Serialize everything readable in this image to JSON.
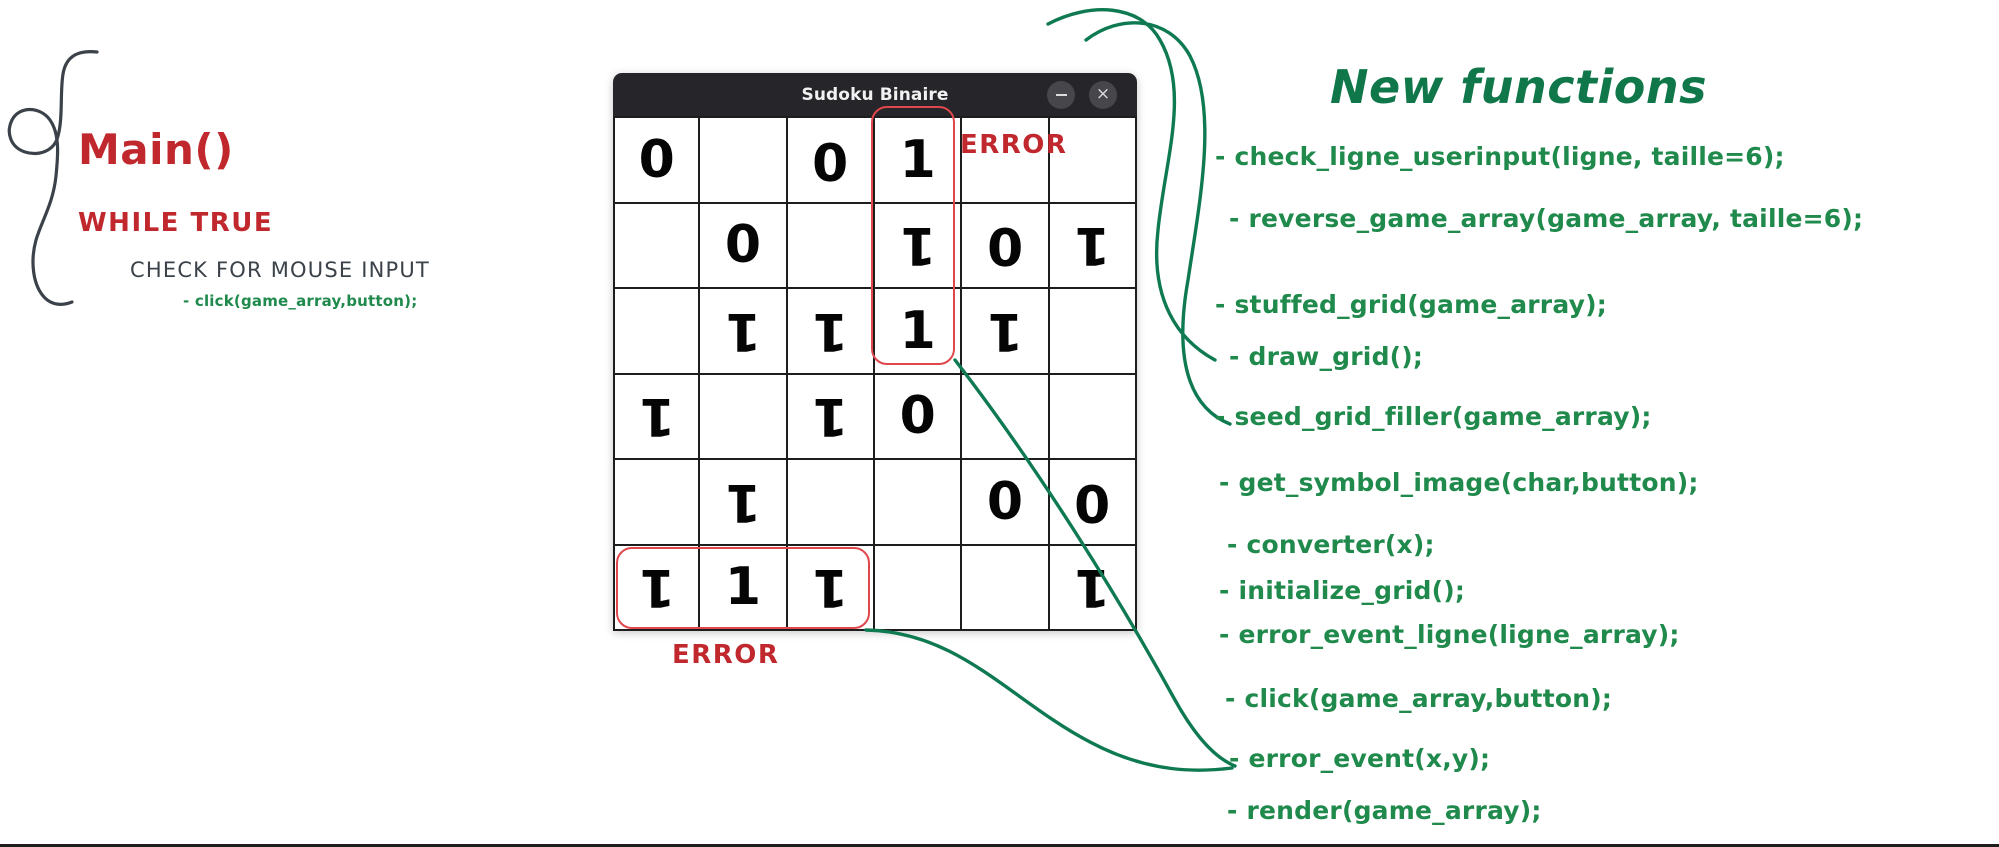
{
  "left_panel": {
    "main_label": "Main()",
    "while_label": "WHILE TRUE",
    "check_label": "CHECK FOR MOUSE INPUT",
    "click_label": "- click(game_array,button);"
  },
  "app_window": {
    "title": "Sudoku Binaire",
    "minimize_label": "–",
    "close_label": "×"
  },
  "annotations": {
    "error_top": "ERROR",
    "error_bottom": "ERROR"
  },
  "functions_panel": {
    "title": "New functions",
    "items": [
      "- check_ligne_userinput(ligne, taille=6);",
      "- reverse_game_array(game_array, taille=6);",
      "- stuffed_grid(game_array);",
      "- draw_grid();",
      "- seed_grid_filler(game_array);",
      "- get_symbol_image(char,button);",
      "- converter(x);",
      "- initialize_grid();",
      "- error_event_ligne(ligne_array);",
      "- click(game_array,button);",
      "- error_event(x,y);",
      "- render(game_array);"
    ]
  },
  "colors": {
    "red_accent": "#c0282d",
    "green_accent": "#1f8a4c",
    "green_title": "#10774a",
    "ink": "#3b4249",
    "titlebar": "#26262a",
    "error_box": "#e0474c"
  },
  "chart_data": {
    "type": "table",
    "title": "Sudoku Binaire",
    "rows": 6,
    "cols": 6,
    "legend": {
      "0": "zero symbol, upright",
      "0r": "zero symbol, rotated 180 degrees",
      "1": "one symbol, upright",
      "1r": "one symbol, rotated 180 degrees",
      "": "empty cell"
    },
    "cells": [
      [
        "0",
        "",
        "0r",
        "1",
        "",
        ""
      ],
      [
        "",
        "0",
        "",
        "1r",
        "0r",
        "1r"
      ],
      [
        "",
        "1r",
        "1r",
        "1",
        "1r",
        ""
      ],
      [
        "1r",
        "",
        "1r",
        "0",
        "",
        ""
      ],
      [
        "",
        "1r",
        "",
        "",
        "0",
        "0r"
      ],
      [
        "1r",
        "1",
        "1r",
        "",
        "",
        "1r"
      ]
    ],
    "error_column_index": 3,
    "error_row_index": 5
  }
}
